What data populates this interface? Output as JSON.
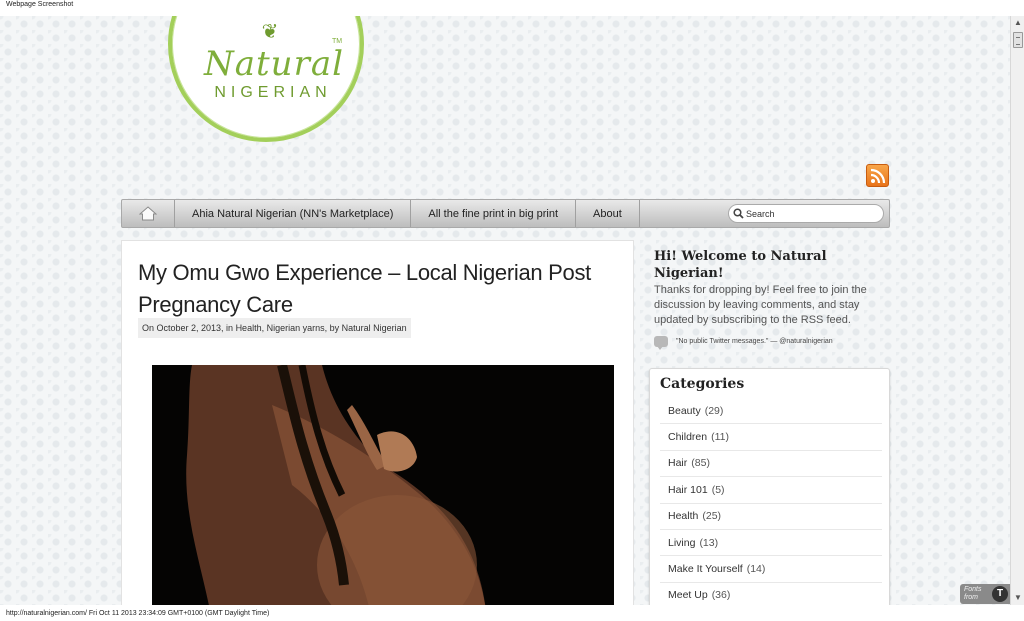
{
  "window": {
    "caption": "Webpage Screenshot",
    "status": "http://naturalnigerian.com/  Fri Oct 11 2013 23:34:09 GMT+0100 (GMT Daylight Time)"
  },
  "logo": {
    "line1": "Natural",
    "tm": "TM",
    "line2": "NIGERIAN",
    "brand_color": "#7fae3b"
  },
  "nav": {
    "home_icon": "home-icon",
    "items": [
      "Ahia Natural Nigerian (NN's Marketplace)",
      "All the fine print in big print",
      "About"
    ],
    "search_placeholder": "Search"
  },
  "post": {
    "title": "My Omu Gwo Experience – Local Nigerian Post Pregnancy Care",
    "meta_prefix": "On October 2, 2013, in ",
    "categories": [
      "Health",
      "Nigerian yarns"
    ],
    "meta_by": ", by ",
    "author": "Natural Nigerian"
  },
  "sidebar": {
    "welcome_title": "Hi! Welcome to Natural Nigerian!",
    "welcome_text": "Thanks for dropping by! Feel free to join the discussion by leaving comments, and stay updated by subscribing to the RSS feed.",
    "twitter_text": "\"No public Twitter messages.\" — @naturalnigerian",
    "categories_title": "Categories",
    "categories": [
      {
        "name": "Beauty",
        "count": "(29)"
      },
      {
        "name": "Children",
        "count": "(11)"
      },
      {
        "name": "Hair",
        "count": "(85)"
      },
      {
        "name": "Hair 101",
        "count": "(5)"
      },
      {
        "name": "Health",
        "count": "(25)"
      },
      {
        "name": "Living",
        "count": "(13)"
      },
      {
        "name": "Make It Yourself",
        "count": "(14)"
      },
      {
        "name": "Meet Up",
        "count": "(36)"
      }
    ]
  },
  "badge": {
    "line1": "Fonts",
    "line2": "from",
    "mark": "T"
  }
}
